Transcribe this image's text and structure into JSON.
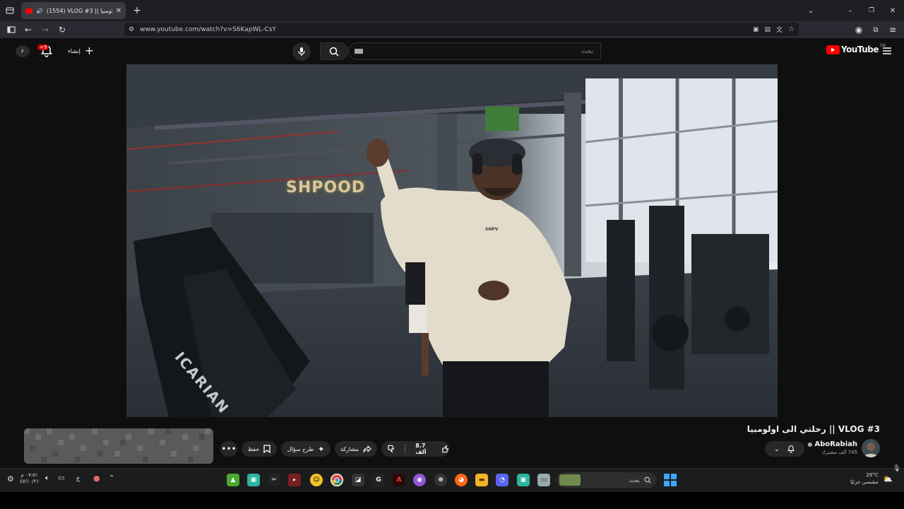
{
  "browser": {
    "tab_title": "(1554) VLOG #3 || رحلتي الى اولومبيا",
    "url": "www.youtube.com/watch?v=S6KapWL-CsY"
  },
  "header": {
    "logo_text": "YouTube",
    "region": "SA",
    "search_placeholder": "بحث",
    "create_label": "إنشاء",
    "notifications_badge": "+9"
  },
  "video": {
    "title": "VLOG #3 || رحلتي الى اولومبيا",
    "sign_text": "SHPOOD",
    "shirt_text": "SNPV",
    "machine_brand": "ICARIAN"
  },
  "channel": {
    "name": "AboRabiah",
    "subscribers": "745 ألف مشترك"
  },
  "actions": {
    "likes": "8.7 ألف",
    "share": "مشاركة",
    "ask": "طرح سؤال",
    "save": "حفظ"
  },
  "taskbar": {
    "search": "بحث",
    "weather_temp": "29°C",
    "weather_desc": "مشمس جزئيًا",
    "time": "٠٧:٥١ م",
    "date": "٤٧/١٠/٢١",
    "lang": "ع"
  }
}
